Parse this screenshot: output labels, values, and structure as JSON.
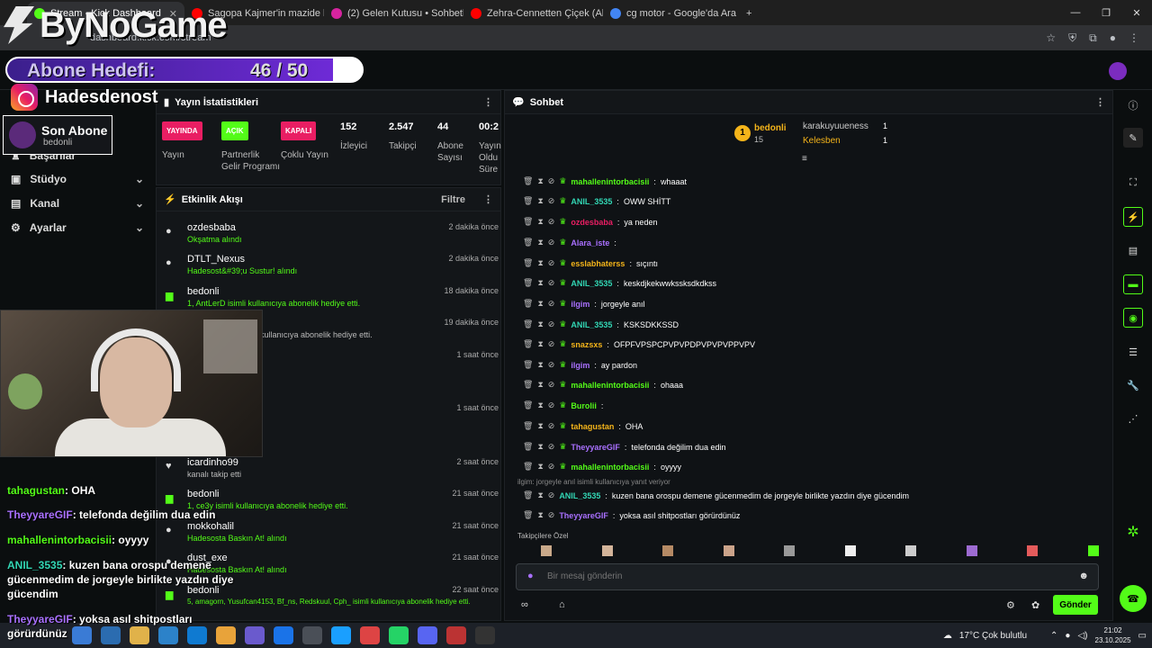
{
  "tabs": [
    {
      "label": "Stream - Kick Dashboard",
      "color": "#53fc18",
      "active": true
    },
    {
      "label": "Sagopa Kajmer'in mazide kalan",
      "color": "#ff0000",
      "active": false
    },
    {
      "label": "(2) Gelen Kutusu • Sohbetler",
      "color": "#d6249f",
      "active": false
    },
    {
      "label": "Zehra-Cennetten Çiçek (Alp",
      "color": "#ff0000",
      "active": false
    },
    {
      "label": "cg motor - Google'da Ara",
      "color": "#4285f4",
      "active": false
    }
  ],
  "address": {
    "url": "dashboard.kick.com/stream"
  },
  "overlay": {
    "logo_text": "ByNoGame",
    "goal_label": "Abone Hedefi:",
    "goal_count": "46 / 50",
    "goal_progress": 0.92,
    "instagram": "Hadesdenost",
    "last_sub_title": "Son Abone",
    "last_sub_name": "bedonli"
  },
  "sidebar": {
    "items": [
      {
        "label": "Başarılar",
        "icon": "trophy-icon"
      },
      {
        "label": "Stüdyo",
        "icon": "studio-icon",
        "chev": "⌄"
      },
      {
        "label": "Kanal",
        "icon": "channel-icon",
        "chev": "⌄"
      },
      {
        "label": "Ayarlar",
        "icon": "gear-icon",
        "chev": "⌄"
      }
    ]
  },
  "stats": {
    "title": "Yayın İstatistikleri",
    "items": [
      {
        "pill": "YAYINDA",
        "pill_color": "#e91e63",
        "label": "Yayın"
      },
      {
        "pill": "AÇIK",
        "pill_color": "#53fc18",
        "label": "Partnerlik Gelir Programı"
      },
      {
        "pill": "KAPALI",
        "pill_color": "#e91e63",
        "label": "Çoklu Yayın"
      },
      {
        "value": "152",
        "label": "İzleyici"
      },
      {
        "value": "2.547",
        "label": "Takipçi"
      },
      {
        "value": "44",
        "label": "Abone Sayısı"
      },
      {
        "value": "00:2",
        "label": "Yayın Oldu Süre"
      }
    ]
  },
  "activity": {
    "title": "Etkinlik Akışı",
    "filter": "Filtre",
    "events": [
      {
        "name": "ozdesbaba",
        "detail": "Okşatma alındı",
        "time": "2 dakika önce",
        "icon": "gift-icon"
      },
      {
        "name": "DTLT_Nexus",
        "detail": "Hadesost&#39;u Sustur! alındı",
        "time": "2 dakika önce",
        "icon": "gift-icon"
      },
      {
        "name": "bedonli",
        "detail": "1, AntLerD isimli kullanıcıya abonelik hediye etti.",
        "time": "18 dakika önce",
        "icon": "sub-gift-icon"
      },
      {
        "name": "",
        "detail": "kullanıcıya abonelik hediye etti.",
        "time": "19 dakika önce",
        "icon": ""
      },
      {
        "name": "",
        "detail": "",
        "time": "1 saat önce",
        "icon": ""
      },
      {
        "name": "",
        "detail": "",
        "time": "1 saat önce",
        "icon": ""
      },
      {
        "name": "icardinho99",
        "detail": "kanalı takip etti",
        "time": "2 saat önce",
        "icon": "heart-icon"
      },
      {
        "name": "bedonli",
        "detail": "1, ce3y isimli kullanıcıya abonelik hediye etti.",
        "time": "21 saat önce",
        "icon": "sub-gift-icon"
      },
      {
        "name": "mokkohalil",
        "detail": "Hadesosta Baskın At! alındı",
        "time": "21 saat önce",
        "icon": "gift-icon"
      },
      {
        "name": "dust_exe",
        "detail": "Hadesosta Baskın At! alındı",
        "time": "21 saat önce",
        "icon": "gift-icon"
      },
      {
        "name": "bedonli",
        "detail": "5, amagorn, Yusufcan4153, Bf_ns, Redskuul, Cph_ isimli kullanıcıya abonelik hediye etti.",
        "time": "22 saat önce",
        "icon": "sub-gift-icon"
      }
    ]
  },
  "overlay_chat": [
    {
      "user": "tahagustan",
      "text": "OHA",
      "color": "#53fc18"
    },
    {
      "user": "TheyyareGIF",
      "text": "telefonda değilim dua edin",
      "color": "#a970ff"
    },
    {
      "user": "mahallenintorbacisii",
      "text": "oyyyy",
      "color": "#53fc18"
    },
    {
      "user": "ANIL_3535",
      "text": "kuzen bana orospu demene gücenmedim de jorgeyle birlikte yazdın diye gücendim",
      "color": "#32d6b4"
    },
    {
      "user": "TheyyareGIF",
      "text": "yoksa asıl shitpostları görürdünüz",
      "color": "#a970ff"
    }
  ],
  "chat": {
    "title": "Sohbet",
    "leaders": [
      {
        "rank": "1",
        "name": "bedonli",
        "count": "15",
        "color": "#f4b41a"
      },
      {
        "name": "karakuyuueness",
        "count": "1",
        "color": "#ccc"
      },
      {
        "name": "Kelesben",
        "count": "1",
        "color": "#f4b41a"
      }
    ],
    "messages": [
      {
        "user": "mahallenintorbacisii",
        "text": "whaaat",
        "color": "#53fc18"
      },
      {
        "user": "ANIL_3535",
        "text": "OWW SHİTT",
        "color": "#32d6b4"
      },
      {
        "user": "ozdesbaba",
        "text": "ya neden",
        "color": "#e91e63"
      },
      {
        "user": "Alara_iste",
        "text": "",
        "color": "#a970ff"
      },
      {
        "user": "esslabhaterss",
        "text": "sıçıntı",
        "color": "#f4b41a"
      },
      {
        "user": "ANIL_3535",
        "text": "keskdjkekwwkssksdkdkss",
        "color": "#32d6b4"
      },
      {
        "user": "ilgim",
        "text": "jorgeyle anıl",
        "color": "#a970ff"
      },
      {
        "user": "ANIL_3535",
        "text": "KSKSDKKSSD",
        "color": "#32d6b4"
      },
      {
        "user": "snazsxs",
        "text": "OFPFVPSPCPVPVPDPVPVPVPPVPV",
        "color": "#f4b41a"
      },
      {
        "user": "ilgim",
        "text": "ay pardon",
        "color": "#a970ff"
      },
      {
        "user": "mahallenintorbacisii",
        "text": "ohaaa",
        "color": "#53fc18"
      },
      {
        "user": "Burolii",
        "text": "",
        "color": "#53fc18"
      },
      {
        "user": "tahagustan",
        "text": "OHA",
        "color": "#f4b41a"
      },
      {
        "user": "TheyyareGIF",
        "text": "telefonda değilim dua edin",
        "color": "#a970ff"
      },
      {
        "user": "mahallenintorbacisii",
        "text": "oyyyy",
        "color": "#53fc18"
      }
    ],
    "reply_note": "ilgim: jorgeyle anıl isimli kullanıcıya yanıt veriyor",
    "messages2": [
      {
        "user": "ANIL_3535",
        "text": "kuzen bana orospu demene gücenmedim de jorgeyle birlikte yazdın diye gücendim",
        "color": "#32d6b4"
      },
      {
        "user": "TheyyareGIF",
        "text": "yoksa asıl shitpostları görürdünüz",
        "color": "#a970ff"
      }
    ],
    "emote_label": "Takipçilere Özel",
    "input_placeholder": "Bir mesaj gönderin",
    "send": "Gönder"
  },
  "taskbar": {
    "weather": "17°C  Çok bulutlu",
    "time": "21:02",
    "date": "23.10.2025"
  }
}
